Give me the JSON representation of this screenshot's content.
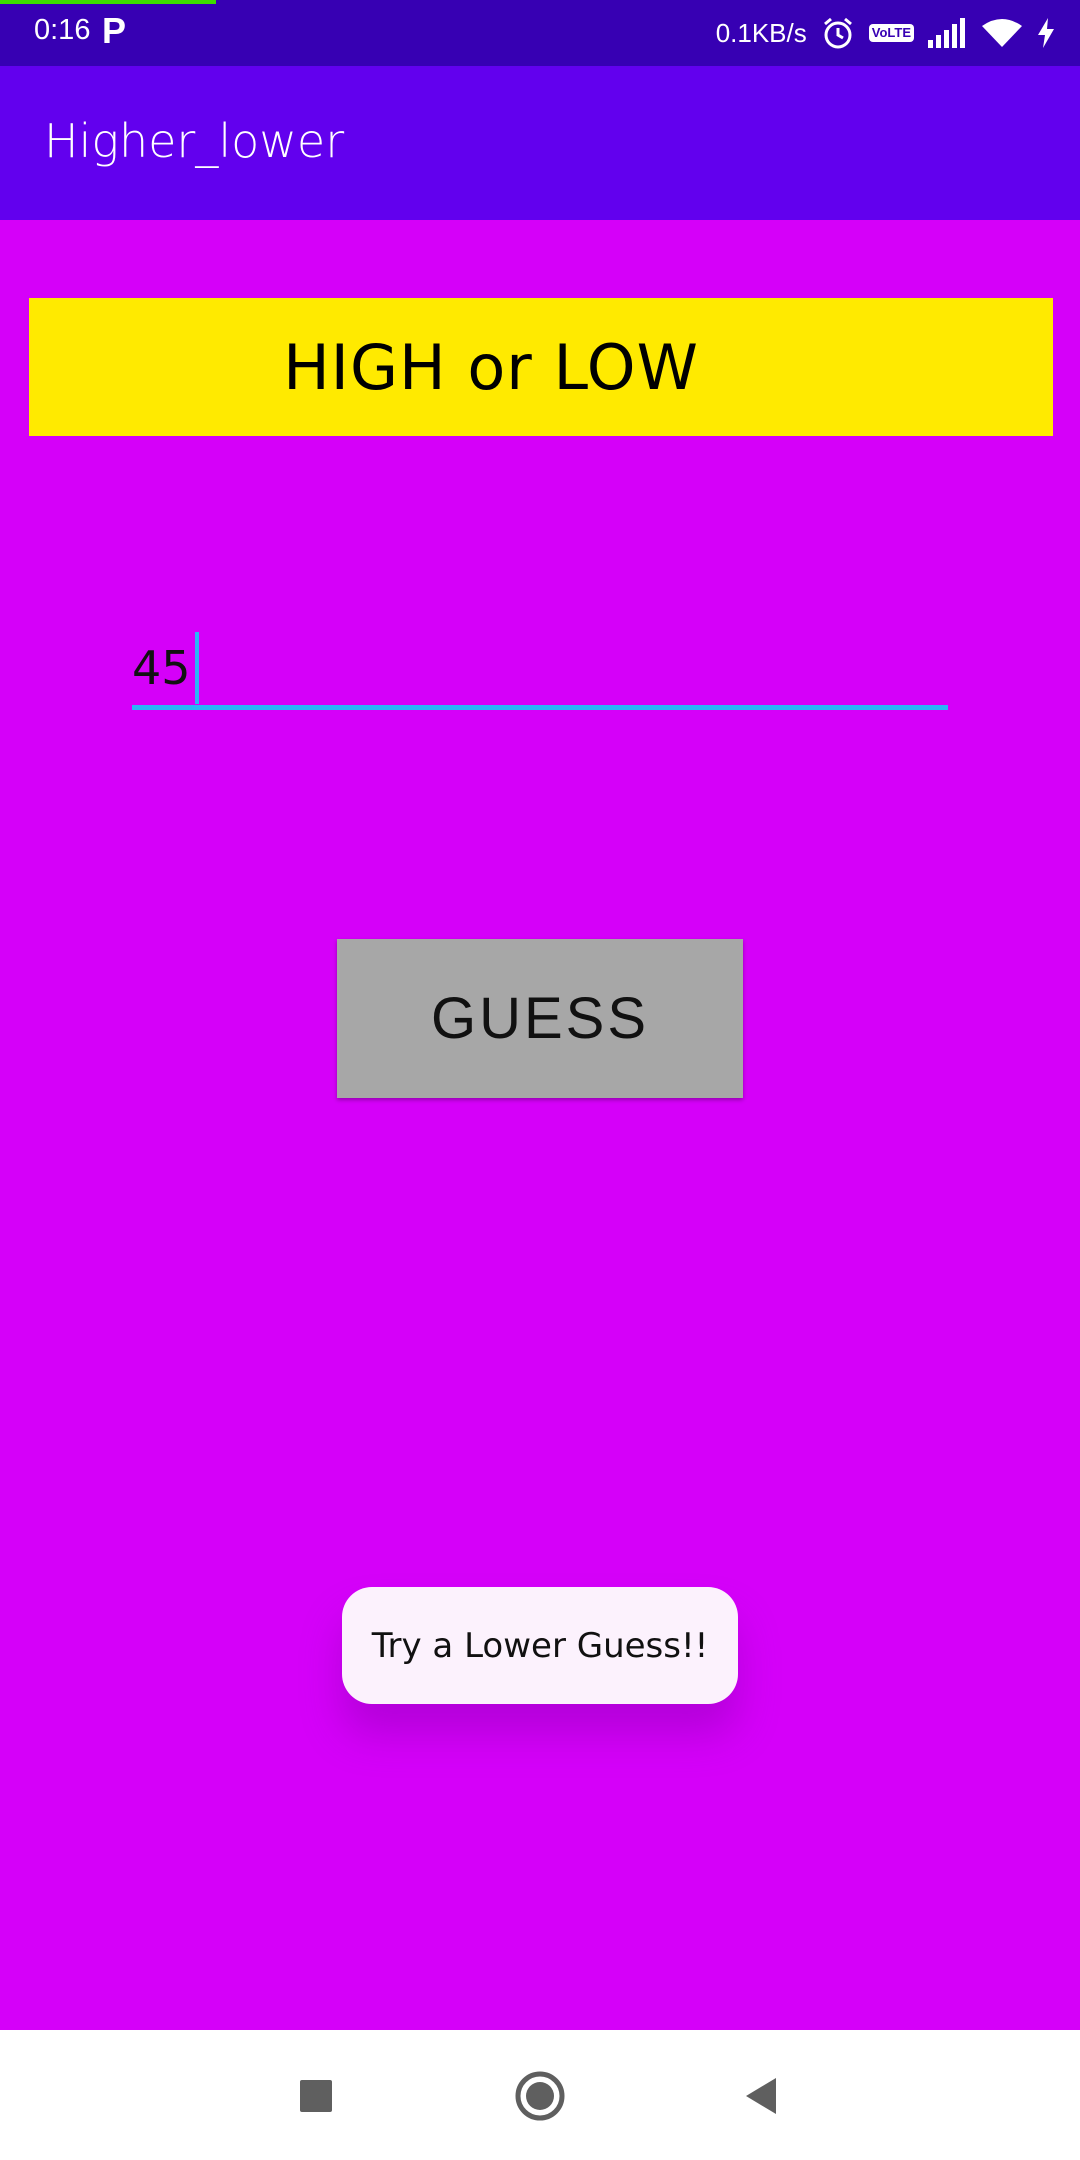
{
  "status_bar": {
    "time": "0:16",
    "notification_glyph": "P",
    "net_speed": "0.1KB/s",
    "volte_line1": "Vo",
    "volte_line2": "LTE",
    "icons": [
      "alarm-icon",
      "volte-icon",
      "signal-icon",
      "wifi-icon",
      "charging-icon"
    ]
  },
  "app_bar": {
    "title": "Higher_lower"
  },
  "banner": {
    "text": "HIGH or LOW"
  },
  "guess_input": {
    "value": "45"
  },
  "guess_button": {
    "label": "GUESS"
  },
  "toast": {
    "message": "Try a Lower Guess!!"
  },
  "nav_bar": {
    "icons": [
      "recents-icon",
      "home-icon",
      "back-icon"
    ]
  },
  "colors": {
    "status_bar": "#3700b3",
    "app_bar": "#6200ee",
    "background": "#d500f9",
    "banner": "#ffea00",
    "accent": "#29b6f6",
    "button": "#a7a7a7"
  }
}
